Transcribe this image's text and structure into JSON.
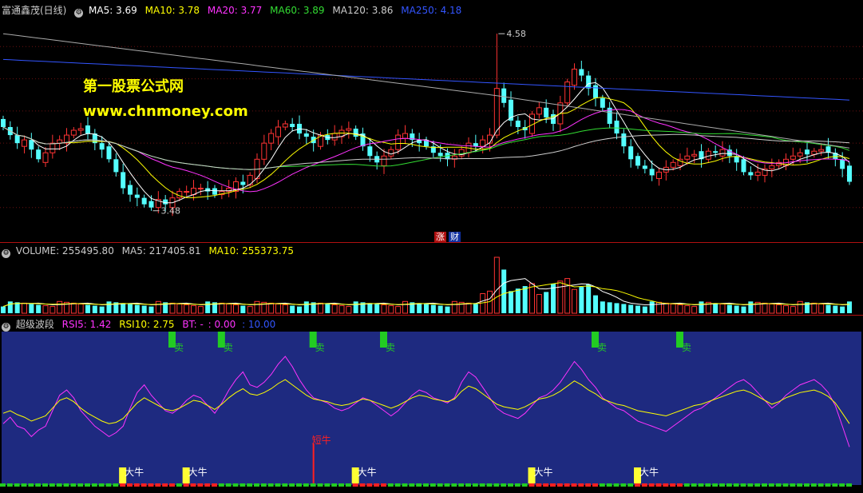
{
  "price_panel": {
    "stock_name": "富通鑫茂(日线)",
    "indicators": [
      {
        "label": "MA5: 3.69",
        "color": "#ffffff"
      },
      {
        "label": "MA10: 3.78",
        "color": "#ffff00"
      },
      {
        "label": "MA20: 3.77",
        "color": "#ff33ff"
      },
      {
        "label": "MA60: 3.89",
        "color": "#33dd33"
      },
      {
        "label": "MA120: 3.86",
        "color": "#cccccc"
      },
      {
        "label": "MA250: 4.18",
        "color": "#3355ff"
      }
    ],
    "high_label": "4.58",
    "low_label": "3.48",
    "tag_zhang": "涨",
    "tag_cai": "财"
  },
  "watermark": {
    "line1": "第一股票公式网",
    "line2": "www.chnmoney.com"
  },
  "volume_panel": {
    "indicators": [
      {
        "label": "VOLUME: 255495.80",
        "color": "#cccccc"
      },
      {
        "label": "MA5: 217405.81",
        "color": "#cccccc"
      },
      {
        "label": "MA10: 255373.75",
        "color": "#ffff00"
      }
    ]
  },
  "wave_panel": {
    "name": "超级波段",
    "indicators": [
      {
        "label": "RSI5: 1.42",
        "color": "#ff33ff"
      },
      {
        "label": "RSI10: 2.75",
        "color": "#ffff00"
      },
      {
        "label": "BT: -",
        "color": "#ff33ff"
      },
      {
        "label": ": 0.00",
        "color": "#ff33ff"
      },
      {
        "label": ": 10.00",
        "color": "#3355ff"
      }
    ],
    "sell_label": "卖",
    "bull_label": "大牛",
    "short_label": "短牛"
  },
  "colors": {
    "up": "#ff3333",
    "down": "#54ffff",
    "ma5": "#ffffff",
    "ma10": "#ffff00",
    "ma20": "#ff33ff",
    "ma60": "#33dd33",
    "ma120": "#cccccc",
    "ma250": "#3355ff",
    "wave_bg": "#1e2a80",
    "border": "#b01010"
  },
  "chart_data": [
    {
      "type": "candlestick",
      "title": "富通鑫茂(日线)",
      "ylim": [
        3.3,
        4.7
      ],
      "annotations": [
        {
          "label": "4.58",
          "value": 4.58
        },
        {
          "label": "3.48",
          "value": 3.48
        }
      ],
      "series": [
        {
          "name": "MA5",
          "last": 3.69
        },
        {
          "name": "MA10",
          "last": 3.78
        },
        {
          "name": "MA20",
          "last": 3.77
        },
        {
          "name": "MA60",
          "last": 3.89
        },
        {
          "name": "MA120",
          "last": 3.86
        },
        {
          "name": "MA250",
          "last": 4.18
        }
      ],
      "closes": [
        4.0,
        3.95,
        3.9,
        3.92,
        3.86,
        3.8,
        3.84,
        3.9,
        3.92,
        3.95,
        3.98,
        3.99,
        3.96,
        3.9,
        3.86,
        3.8,
        3.72,
        3.62,
        3.58,
        3.56,
        3.52,
        3.5,
        3.55,
        3.52,
        3.56,
        3.6,
        3.6,
        3.62,
        3.62,
        3.6,
        3.58,
        3.6,
        3.62,
        3.66,
        3.64,
        3.7,
        3.8,
        3.9,
        3.96,
        4.0,
        4.02,
        4.0,
        3.96,
        3.94,
        3.9,
        3.95,
        3.92,
        3.96,
        3.98,
        3.99,
        3.94,
        3.88,
        3.82,
        3.78,
        3.82,
        3.86,
        3.95,
        3.96,
        3.92,
        3.9,
        3.88,
        3.84,
        3.82,
        3.8,
        3.82,
        3.86,
        3.9,
        3.88,
        3.92,
        3.95,
        4.24,
        4.15,
        4.04,
        4.0,
        3.98,
        4.08,
        4.12,
        4.06,
        4.02,
        4.15,
        4.28,
        4.36,
        4.32,
        4.24,
        4.18,
        4.12,
        4.02,
        3.96,
        3.88,
        3.8,
        3.76,
        3.74,
        3.7,
        3.72,
        3.75,
        3.78,
        3.8,
        3.82,
        3.83,
        3.8,
        3.85,
        3.84,
        3.86,
        3.82,
        3.78,
        3.72,
        3.7,
        3.72,
        3.74,
        3.76,
        3.78,
        3.8,
        3.82,
        3.84,
        3.83,
        3.85,
        3.86,
        3.84,
        3.8,
        3.74,
        3.66
      ],
      "volume": {
        "last": 255495.8,
        "ma5": 217405.81,
        "ma10": 255373.75
      }
    },
    {
      "type": "line",
      "title": "超级波段",
      "ylim": [
        0,
        100
      ],
      "series": [
        {
          "name": "RSI5",
          "last": 1.42,
          "values": [
            40,
            45,
            38,
            36,
            30,
            35,
            38,
            50,
            62,
            66,
            60,
            50,
            44,
            38,
            34,
            30,
            33,
            38,
            52,
            64,
            70,
            62,
            56,
            50,
            48,
            52,
            58,
            62,
            60,
            54,
            48,
            56,
            66,
            74,
            80,
            70,
            68,
            72,
            78,
            86,
            92,
            84,
            74,
            66,
            60,
            58,
            56,
            52,
            50,
            52,
            56,
            60,
            58,
            54,
            50,
            46,
            50,
            56,
            62,
            66,
            64,
            60,
            58,
            56,
            60,
            72,
            80,
            76,
            68,
            60,
            52,
            48,
            46,
            44,
            48,
            54,
            60,
            62,
            66,
            72,
            80,
            88,
            82,
            74,
            68,
            60,
            56,
            52,
            50,
            46,
            42,
            40,
            38,
            36,
            34,
            38,
            42,
            46,
            50,
            52,
            56,
            60,
            64,
            68,
            72,
            74,
            70,
            64,
            58,
            52,
            56,
            62,
            66,
            70,
            72,
            74,
            70,
            64,
            54,
            38,
            22
          ]
        },
        {
          "name": "RSI10",
          "last": 2.75,
          "values": [
            48,
            50,
            47,
            45,
            42,
            44,
            46,
            52,
            58,
            60,
            57,
            52,
            48,
            45,
            42,
            40,
            41,
            44,
            50,
            56,
            60,
            57,
            54,
            51,
            50,
            52,
            55,
            58,
            57,
            54,
            51,
            55,
            60,
            64,
            67,
            63,
            62,
            64,
            67,
            71,
            74,
            70,
            66,
            62,
            59,
            58,
            57,
            55,
            54,
            55,
            57,
            59,
            58,
            56,
            54,
            52,
            54,
            57,
            60,
            62,
            61,
            59,
            58,
            57,
            59,
            65,
            69,
            67,
            63,
            59,
            55,
            53,
            52,
            51,
            53,
            56,
            59,
            60,
            62,
            65,
            69,
            73,
            70,
            66,
            63,
            59,
            57,
            55,
            54,
            52,
            50,
            49,
            48,
            47,
            46,
            48,
            50,
            52,
            54,
            55,
            57,
            59,
            61,
            63,
            65,
            66,
            64,
            61,
            58,
            55,
            57,
            60,
            62,
            64,
            65,
            66,
            64,
            61,
            56,
            48,
            40
          ]
        }
      ],
      "markers": [
        {
          "label": "卖",
          "index": 24
        },
        {
          "label": "卖",
          "index": 31
        },
        {
          "label": "卖",
          "index": 44
        },
        {
          "label": "卖",
          "index": 54
        },
        {
          "label": "卖",
          "index": 84
        },
        {
          "label": "卖",
          "index": 96
        },
        {
          "label": "大牛",
          "index": 17
        },
        {
          "label": "大牛",
          "index": 26
        },
        {
          "label": "大牛",
          "index": 50
        },
        {
          "label": "大牛",
          "index": 75
        },
        {
          "label": "大牛",
          "index": 90
        },
        {
          "label": "短牛",
          "index": 44
        }
      ]
    }
  ]
}
